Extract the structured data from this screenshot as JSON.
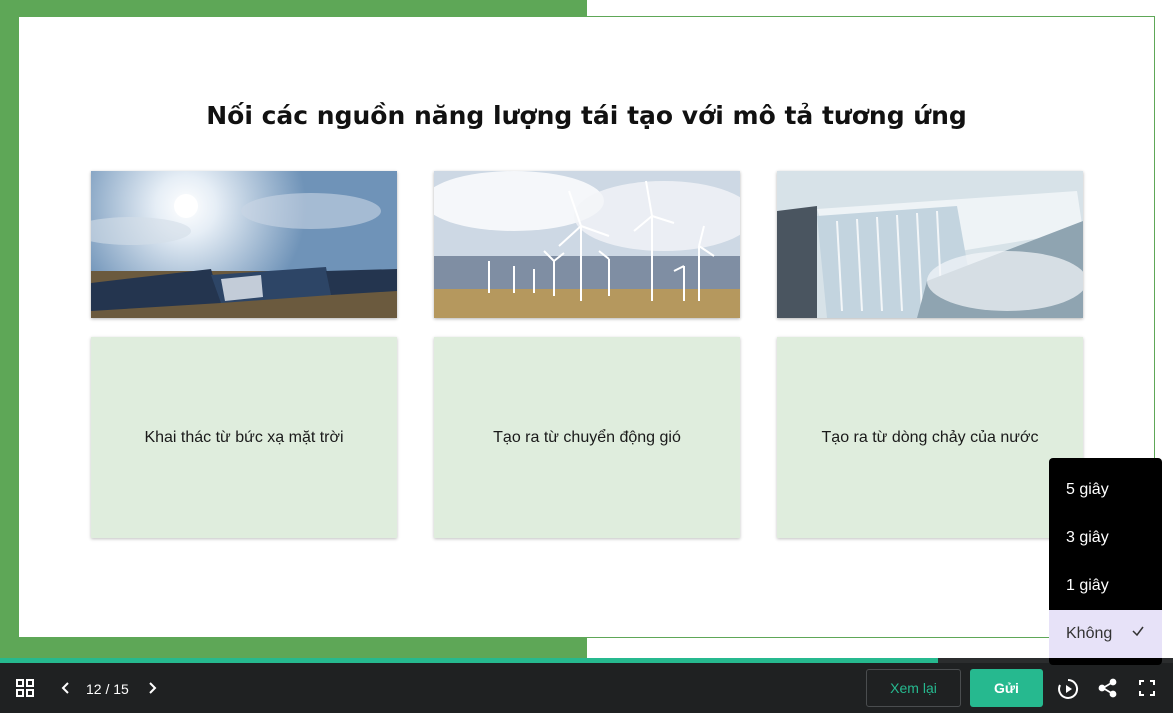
{
  "slide": {
    "title": "Nối các nguồn năng lượng tái tạo với mô tả tương ứng",
    "cards": [
      {
        "image": "solar-panels",
        "description": "Khai thác từ bức xạ mặt trời"
      },
      {
        "image": "wind-turbines",
        "description": "Tạo ra từ chuyển động gió"
      },
      {
        "image": "dam-waterfall",
        "description": "Tạo ra từ dòng chảy của nước"
      }
    ]
  },
  "toolbar": {
    "page_current": "12",
    "page_total": "15",
    "page_label": "12 / 15",
    "progress": 0.8,
    "review_label": "Xem lại",
    "submit_label": "Gửi",
    "icons": [
      "grid-icon",
      "chevron-left-icon",
      "chevron-right-icon",
      "autoplay-icon",
      "share-icon",
      "fullscreen-icon"
    ]
  },
  "autoplay_menu": {
    "options": [
      "5 giây",
      "3 giây",
      "1 giây",
      "Không"
    ],
    "selected": "Không"
  },
  "colors": {
    "accent": "#26b98f",
    "frame_green": "#5ea757",
    "card_bg": "#dfeddd",
    "bar_bg": "#1f2122",
    "selected_bg": "#e7e2f8"
  }
}
